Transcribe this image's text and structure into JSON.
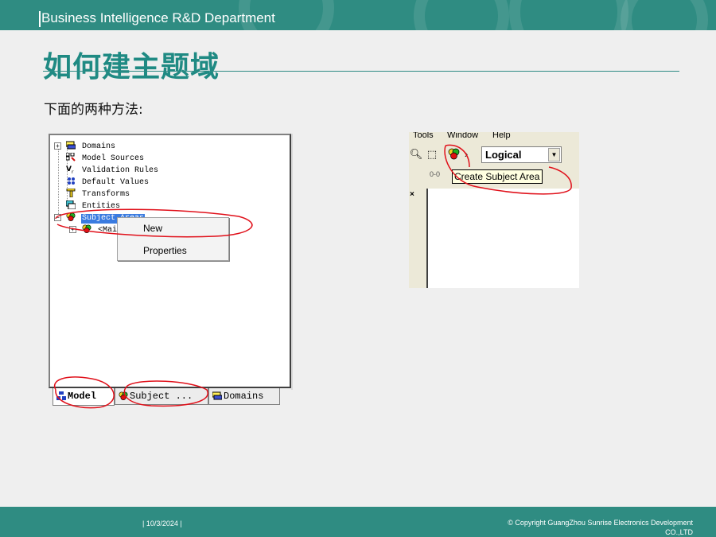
{
  "header": {
    "title": "Business Intelligence R&D Department"
  },
  "slide": {
    "title": "如何建主题域",
    "subtitle": "下面的两种方法:"
  },
  "model_tree": {
    "items": [
      {
        "label": "Domains",
        "icon": "domains-icon"
      },
      {
        "label": "Model Sources",
        "icon": "model-sources-icon"
      },
      {
        "label": "Validation Rules",
        "icon": "validation-rules-icon"
      },
      {
        "label": "Default Values",
        "icon": "default-values-icon"
      },
      {
        "label": "Transforms",
        "icon": "transforms-icon"
      },
      {
        "label": "Entities",
        "icon": "entities-icon"
      },
      {
        "label": "Subject Areas",
        "icon": "subject-area-icon",
        "selected": true
      },
      {
        "label": "<Mair",
        "icon": "subject-area-icon"
      }
    ],
    "context_menu": {
      "new_label": "New",
      "properties_label": "Properties"
    },
    "tabs": [
      {
        "label": "Model",
        "icon": "model-icon",
        "active": true
      },
      {
        "label": "Subject ...",
        "icon": "subject-area-icon"
      },
      {
        "label": "Domains",
        "icon": "domains-icon"
      }
    ]
  },
  "toolbar_view": {
    "menu": {
      "tools": "Tools",
      "window": "Window",
      "help": "Help"
    },
    "view_select": {
      "value": "Logical"
    },
    "tooltip": "Create Subject Area",
    "close_glyph": "×"
  },
  "footer": {
    "date": "| 10/3/2024 |",
    "copyright": "© Copyright GuangZhou Sunrise Electronics Development CO.,LTD"
  },
  "colors": {
    "brand_teal": "#2f8c82",
    "title_teal": "#1f8a83",
    "annotation_red": "#e0101a"
  }
}
